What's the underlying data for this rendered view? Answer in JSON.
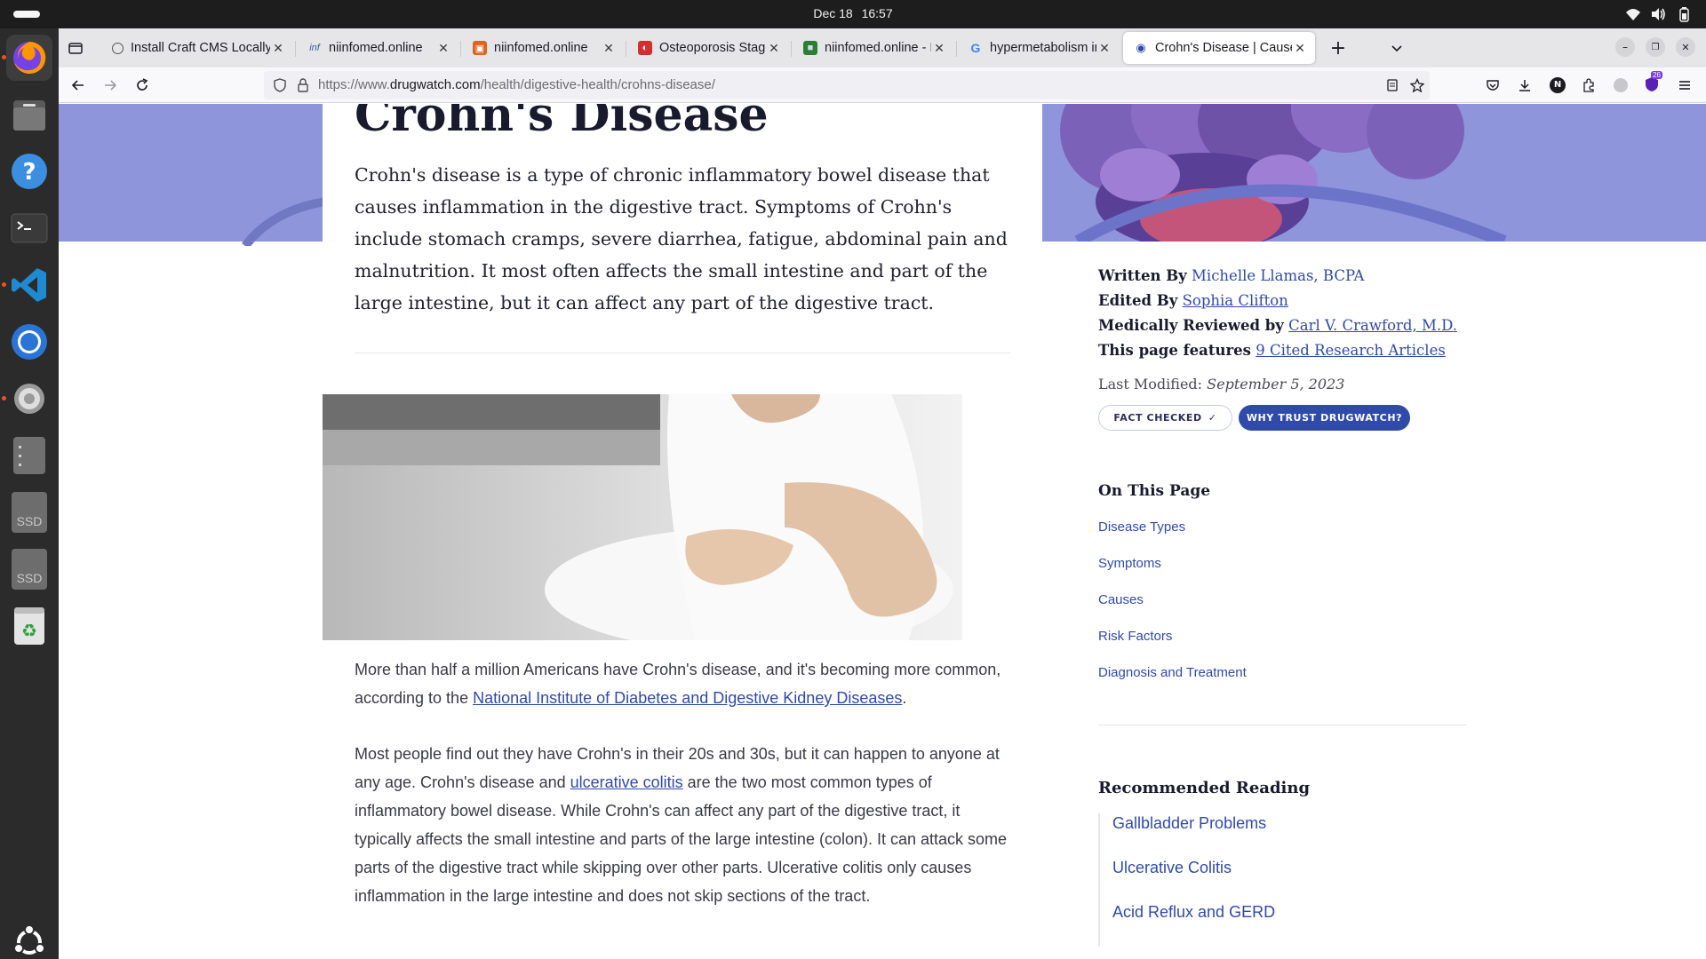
{
  "system": {
    "date": "Dec 18",
    "time": "16:57"
  },
  "dock": {
    "items": [
      {
        "name": "firefox"
      },
      {
        "name": "files"
      },
      {
        "name": "help"
      },
      {
        "name": "terminal"
      },
      {
        "name": "vscode"
      },
      {
        "name": "chrome"
      },
      {
        "name": "settings"
      },
      {
        "name": "disk"
      },
      {
        "name": "ssd-1",
        "label": "SSD"
      },
      {
        "name": "ssd-2",
        "label": "SSD"
      },
      {
        "name": "trash"
      },
      {
        "name": "show-apps"
      }
    ]
  },
  "browser": {
    "tabs": [
      {
        "title": "Install Craft CMS Locally",
        "favicon": "globe"
      },
      {
        "title": "niinfomed.online",
        "favicon": "inf"
      },
      {
        "title": "niinfomed.online",
        "favicon": "orange"
      },
      {
        "title": "Osteoporosis Stages Bor",
        "favicon": "red"
      },
      {
        "title": "niinfomed.online - Healt",
        "favicon": "green"
      },
      {
        "title": "hypermetabolism in ulce",
        "favicon": "google"
      },
      {
        "title": "Crohn's Disease | Causes",
        "favicon": "drugwatch"
      }
    ],
    "url_prefix": "https://www.",
    "url_domain": "drugwatch.com",
    "url_path": "/health/digestive-health/crohns-disease/",
    "extension_badge": "26"
  },
  "article": {
    "title": "Crohn's Disease",
    "intro": "Crohn's disease is a type of chronic inflammatory bowel disease that causes inflammation in the digestive tract. Symptoms of Crohn's include stomach cramps, severe diarrhea, fatigue, abdominal pain and malnutrition. It most often affects the small intestine and part of the large intestine, but it can affect any part of the digestive tract.",
    "para1_before": "More than half a million Americans have Crohn's disease, and it's becoming more common, according to the ",
    "para1_link": "National Institute of Diabetes and Digestive Kidney Diseases",
    "para1_after": ".",
    "para2_before": "Most people find out they have Crohn's in their 20s and 30s, but it can happen to anyone at any age. Crohn's disease and ",
    "para2_link": "ulcerative colitis",
    "para2_after": " are the two most common types of inflammatory bowel disease. While Crohn's can affect any part of the digestive tract, it typically affects the small intestine and parts of the large intestine (colon). It can attack some parts of the digestive tract while skipping over other parts. Ulcerative colitis only causes inflammation in the large intestine and does not skip sections of the tract."
  },
  "sidebar": {
    "written_by_label": "Written By",
    "written_by": "Michelle Llamas, BCPA",
    "edited_by_label": "Edited By",
    "edited_by": "Sophia Clifton",
    "reviewed_by_label": "Medically Reviewed by",
    "reviewed_by": "Carl V. Crawford, M.D.",
    "features_label": "This page features",
    "features_link": "9 Cited Research Articles",
    "last_modified_label": "Last Modified:",
    "last_modified": "September 5, 2023",
    "fact_checked": "FACT CHECKED",
    "why_trust": "WHY TRUST DRUGWATCH?",
    "on_this_page_title": "On This Page",
    "on_this_page": [
      "Disease Types",
      "Symptoms",
      "Causes",
      "Risk Factors",
      "Diagnosis and Treatment"
    ],
    "recommended_title": "Recommended Reading",
    "recommended": [
      "Gallbladder Problems",
      "Ulcerative Colitis",
      "Acid Reflux and GERD"
    ]
  },
  "colors": {
    "brand_blue": "#2f4aa8",
    "hero_band": "#8e95da",
    "dock_bg": "#2b2b2b",
    "ubuntu_orange": "#e95420"
  }
}
